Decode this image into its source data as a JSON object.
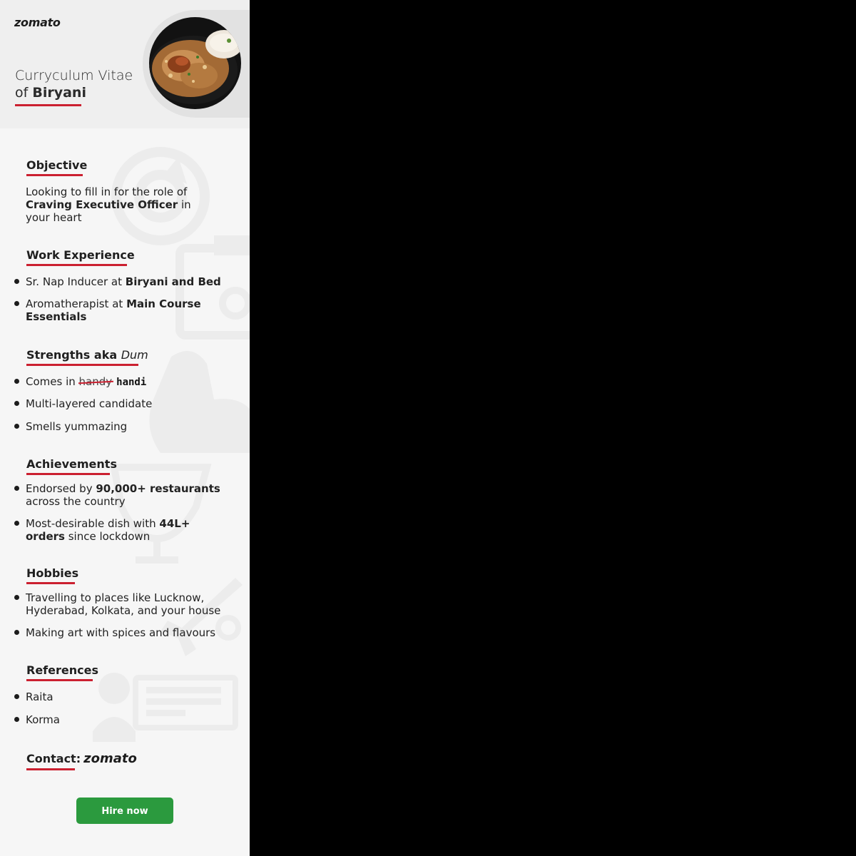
{
  "brand": "zomato",
  "title_line1": "Curryculum Vitae",
  "title_line2_prefix": "of ",
  "title_line2_bold": "Biryani",
  "objective": {
    "heading": "Objective",
    "text_pre": "Looking to fill in for the role of",
    "text_bold": "Craving Executive Officer",
    "text_post": " in your heart"
  },
  "work": {
    "heading": "Work Experience",
    "items": [
      {
        "pre": "Sr. Nap Inducer at ",
        "bold": "Biryani and Bed"
      },
      {
        "pre": "Aromatherapist at ",
        "bold": "Main Course Essentials"
      }
    ]
  },
  "strengths": {
    "heading_main": "Strengths aka ",
    "heading_italic": "Dum",
    "item1_pre": "Comes in ",
    "item1_struck": "handy",
    "item1_hand": "handi",
    "item2": "Multi-layered candidate",
    "item3": "Smells yummazing"
  },
  "achievements": {
    "heading": "Achievements",
    "items": [
      {
        "pre": "Endorsed by ",
        "bold": "90,000+ restaurants",
        "post": " across the country"
      },
      {
        "pre": "Most-desirable dish with ",
        "bold": "44L+ orders",
        "post": " since lockdown"
      }
    ]
  },
  "hobbies": {
    "heading": "Hobbies",
    "items": [
      "Travelling to places like Lucknow, Hyderabad, Kolkata, and your house",
      "Making art with spices and flavours"
    ]
  },
  "references": {
    "heading": "References",
    "items": [
      "Raita",
      "Korma"
    ]
  },
  "contact": {
    "label": "Contact:",
    "brand": "zomato"
  },
  "cta": {
    "label": "Hire now",
    "color": "#2b9a3e"
  },
  "accent_color": "#cb2030"
}
